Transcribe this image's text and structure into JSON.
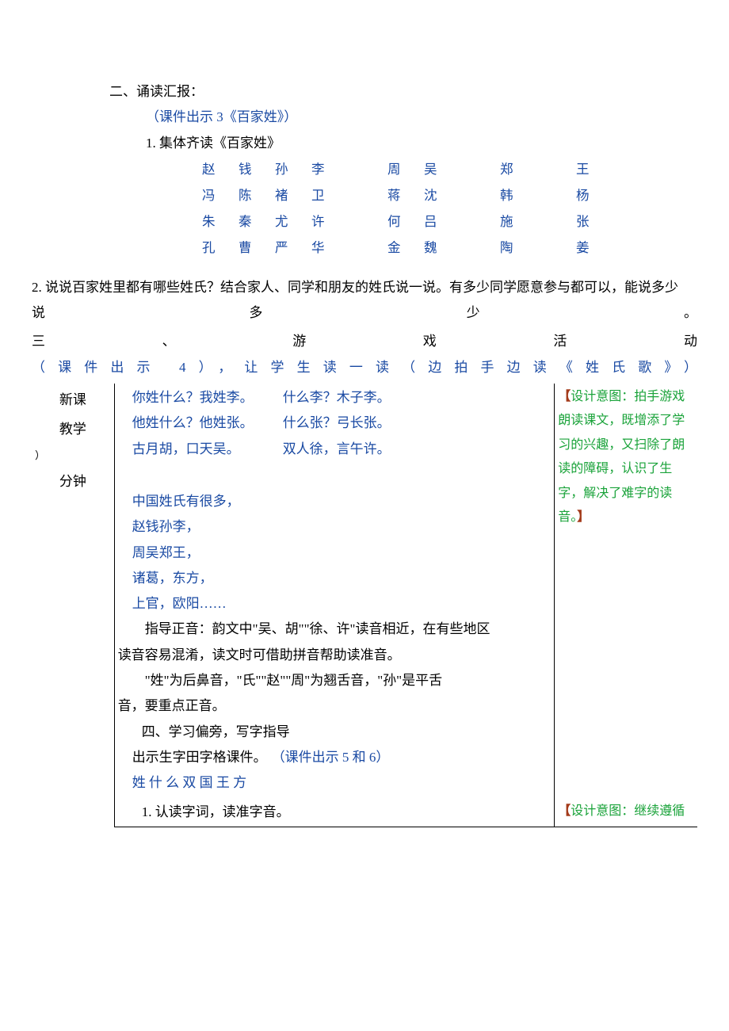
{
  "section2": {
    "title": "二、诵读汇报：",
    "courseware": "（课件出示 3《百家姓》）",
    "item1": "1. 集体齐读《百家姓》",
    "surnames": [
      [
        "赵",
        "钱",
        "孙",
        "李",
        "周",
        "吴",
        "郑",
        "王"
      ],
      [
        "冯",
        "陈",
        "褚",
        "卫",
        "蒋",
        "沈",
        "韩",
        "杨"
      ],
      [
        "朱",
        "秦",
        "尤",
        "许",
        "何",
        "吕",
        "施",
        "张"
      ],
      [
        "孔",
        "曹",
        "严",
        "华",
        "金",
        "魏",
        "陶",
        "姜"
      ]
    ],
    "item2": "2. 说说百家姓里都有哪些姓氏？结合家人、同学和朋友的姓氏说一说。有多少同学愿意参与都可以，能说多少",
    "item2_tail": "说多少。"
  },
  "section3": {
    "title": "三、游戏活动",
    "courseware_line": "（课件出示 4），让学生读一读（边拍手边读《姓氏歌》）"
  },
  "left": {
    "l1": "新课",
    "l2": "教学",
    "l3": "）",
    "l4": "分钟"
  },
  "verses_top": [
    {
      "a": "你姓什么？我姓李。",
      "b": "什么李？木子李。"
    },
    {
      "a": "他姓什么？他姓张。",
      "b": "什么张？弓长张。"
    },
    {
      "a": "古月胡，口天吴。",
      "b": "双人徐，言午许。"
    }
  ],
  "verses_bottom": [
    "中国姓氏有很多，",
    "赵钱孙李，",
    "周吴郑王，",
    "诸葛，东方，",
    "上官，欧阳……"
  ],
  "pronunciation": {
    "p1": "指导正音：韵文中\"吴、胡\"\"徐、许\"读音相近，在有些地区",
    "p2": "读音容易混淆，读文时可借助拼音帮助读准音。",
    "p3": "\"姓\"为后鼻音，\"氏\"\"赵\"\"周\"为翘舌音，\"孙\"是平舌",
    "p4": "音，要重点正音。"
  },
  "section4": {
    "title": "四、学习偏旁，写字指导",
    "line1a": "出示生字田字格课件。",
    "line1b": "（课件出示 5 和 6）",
    "chars": "姓 什 么 双 国 王 方",
    "line2": "1. 认读字词，读准字音。"
  },
  "design_notes": {
    "top_open": "【",
    "top_text": "设计意图：拍手游戏朗读课文，既增添了学习的兴趣，又扫除了朗读的障碍，认识了生字，解决了难字的读音。",
    "top_close": "】",
    "bottom_open": "【",
    "bottom_text": "设计意图：继续遵循"
  }
}
